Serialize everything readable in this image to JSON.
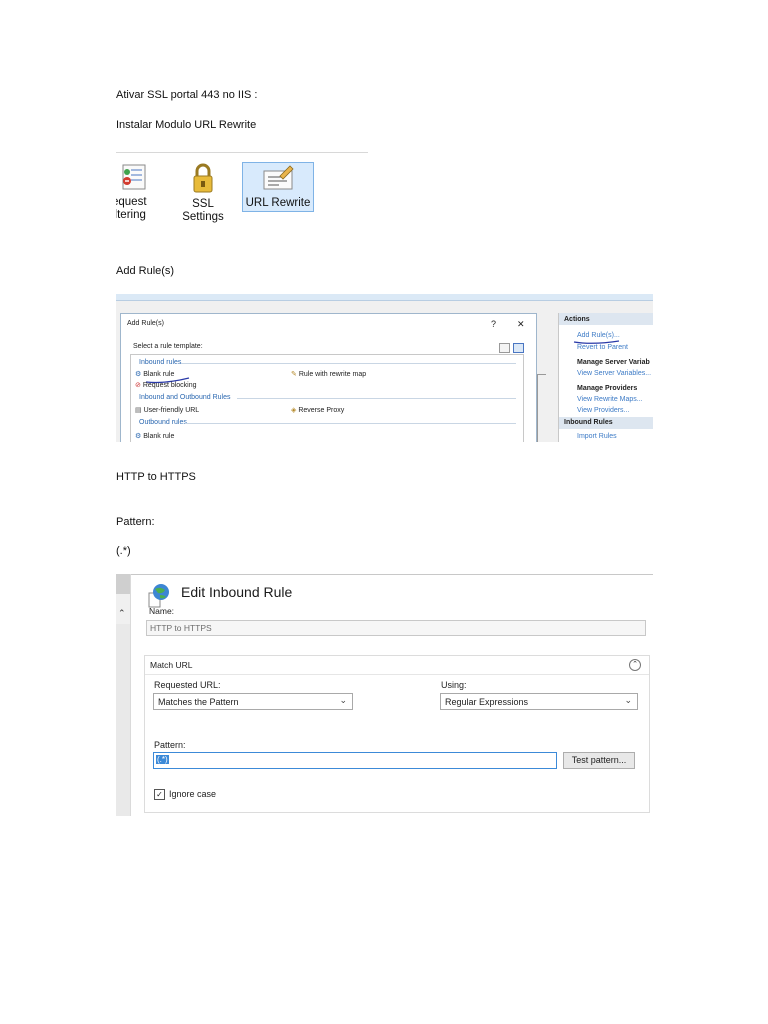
{
  "doc": {
    "line1": "Ativar SSL portal 443 no IIS :",
    "line2": "Instalar Modulo URL Rewrite",
    "line3": "Add Rule(s)",
    "line4": "HTTP to HTTPS",
    "line5": "Pattern:",
    "line6": "(.*)"
  },
  "iis_features": {
    "request_filtering_line1": "equest",
    "request_filtering_line2": "iltering",
    "ssl_settings": "SSL Settings",
    "url_rewrite": "URL Rewrite"
  },
  "add_rules_dialog": {
    "title": "Add Rule(s)",
    "help": "?",
    "close": "✕",
    "select_template": "Select a rule template:",
    "group_inbound": "Inbound rules",
    "blank_rule": "Blank rule",
    "rule_with_map": "Rule with rewrite map",
    "request_blocking": "Request blocking",
    "group_in_out": "Inbound and Outbound Rules",
    "user_friendly_url": "User-friendly URL",
    "reverse_proxy": "Reverse Proxy",
    "group_outbound": "Outbound rules",
    "blank_rule_out": "Blank rule"
  },
  "actions_pane": {
    "header": "Actions",
    "add_rules": "Add Rule(s)...",
    "revert_to_parent": "Revert to Parent",
    "manage_server_vars": "Manage Server Variab",
    "view_server_vars": "View Server Variables...",
    "manage_providers": "Manage Providers",
    "view_rewrite_maps": "View Rewrite Maps...",
    "view_providers": "View Providers...",
    "inbound_rules": "Inbound Rules",
    "import_rules": "Import Rules"
  },
  "edit_inbound_rule": {
    "title": "Edit Inbound Rule",
    "name_label": "Name:",
    "name_value": "HTTP to HTTPS",
    "section_title": "Match URL",
    "requested_url_label": "Requested URL:",
    "requested_url_value": "Matches the Pattern",
    "using_label": "Using:",
    "using_value": "Regular Expressions",
    "pattern_label": "Pattern:",
    "pattern_value": "(.*)",
    "test_pattern_button": "Test pattern...",
    "ignore_case_label": "Ignore case",
    "ignore_case_checked": true
  },
  "colors": {
    "link_blue": "#3d7bc6",
    "selection_blue": "#d8eafc",
    "focus_blue": "#3c8ad8"
  }
}
